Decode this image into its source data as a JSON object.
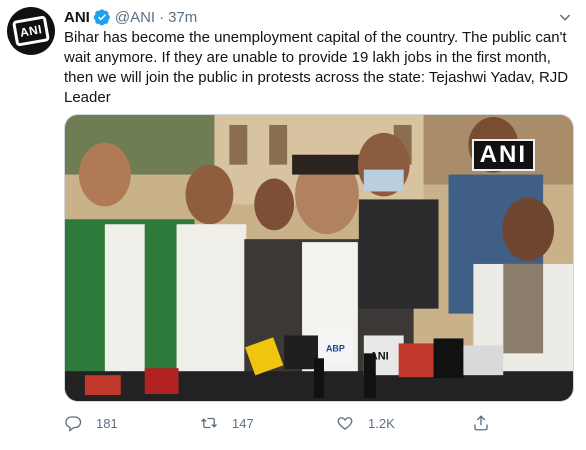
{
  "tweet": {
    "author": {
      "display_name": "ANI",
      "handle": "@ANI",
      "verified": true,
      "avatar_text": "ANI"
    },
    "separator": "·",
    "timestamp": "37m",
    "text": "Bihar has become the unemployment capital of the country. The public can't wait anymore. If they are unable to provide 19 lakh jobs in the first month, then we will join the public in protests across the state: Tejashwi Yadav, RJD Leader",
    "media": {
      "watermark": "ANI",
      "mic_labels": [
        "ANI",
        "ABP"
      ]
    },
    "actions": {
      "reply_count": "181",
      "retweet_count": "147",
      "like_count": "1.2K"
    }
  },
  "colors": {
    "verified_blue": "#1da1f2",
    "muted_text": "#5b7083",
    "primary_text": "#0f1419"
  },
  "icons": [
    "verified-badge-icon",
    "chevron-down-icon",
    "reply-icon",
    "retweet-icon",
    "like-icon",
    "share-icon"
  ]
}
